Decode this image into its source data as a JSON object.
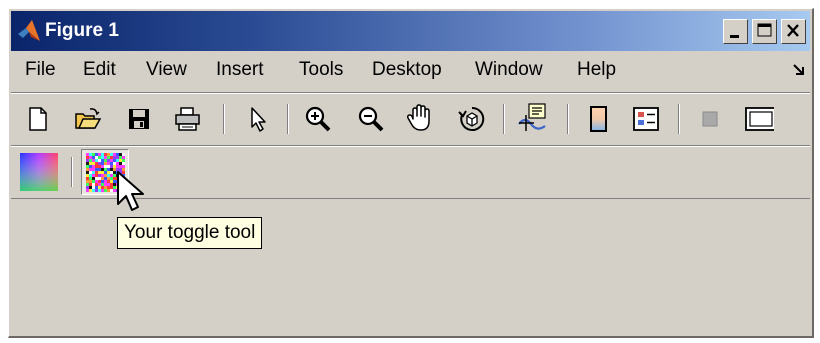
{
  "window": {
    "title": "Figure 1",
    "controls": [
      "minimize-icon",
      "maximize-icon",
      "close-icon"
    ]
  },
  "menubar": {
    "items": [
      "File",
      "Edit",
      "View",
      "Insert",
      "Tools",
      "Desktop",
      "Window",
      "Help"
    ],
    "dock_icon": "dock-arrow-icon"
  },
  "toolbar": {
    "tools": [
      "new-figure-icon",
      "open-file-icon",
      "save-figure-icon",
      "print-figure-icon",
      "edit-plot-icon",
      "zoom-in-icon",
      "zoom-out-icon",
      "pan-icon",
      "rotate-3d-icon",
      "data-cursor-icon",
      "insert-colorbar-icon",
      "insert-legend-icon",
      "hide-plot-tools-icon",
      "show-plot-tools-icon"
    ]
  },
  "custom_toolbar": {
    "tools": [
      "colormap-tool-icon",
      "toggle-tool-icon"
    ],
    "toggle_tooltip": "Your toggle tool"
  }
}
